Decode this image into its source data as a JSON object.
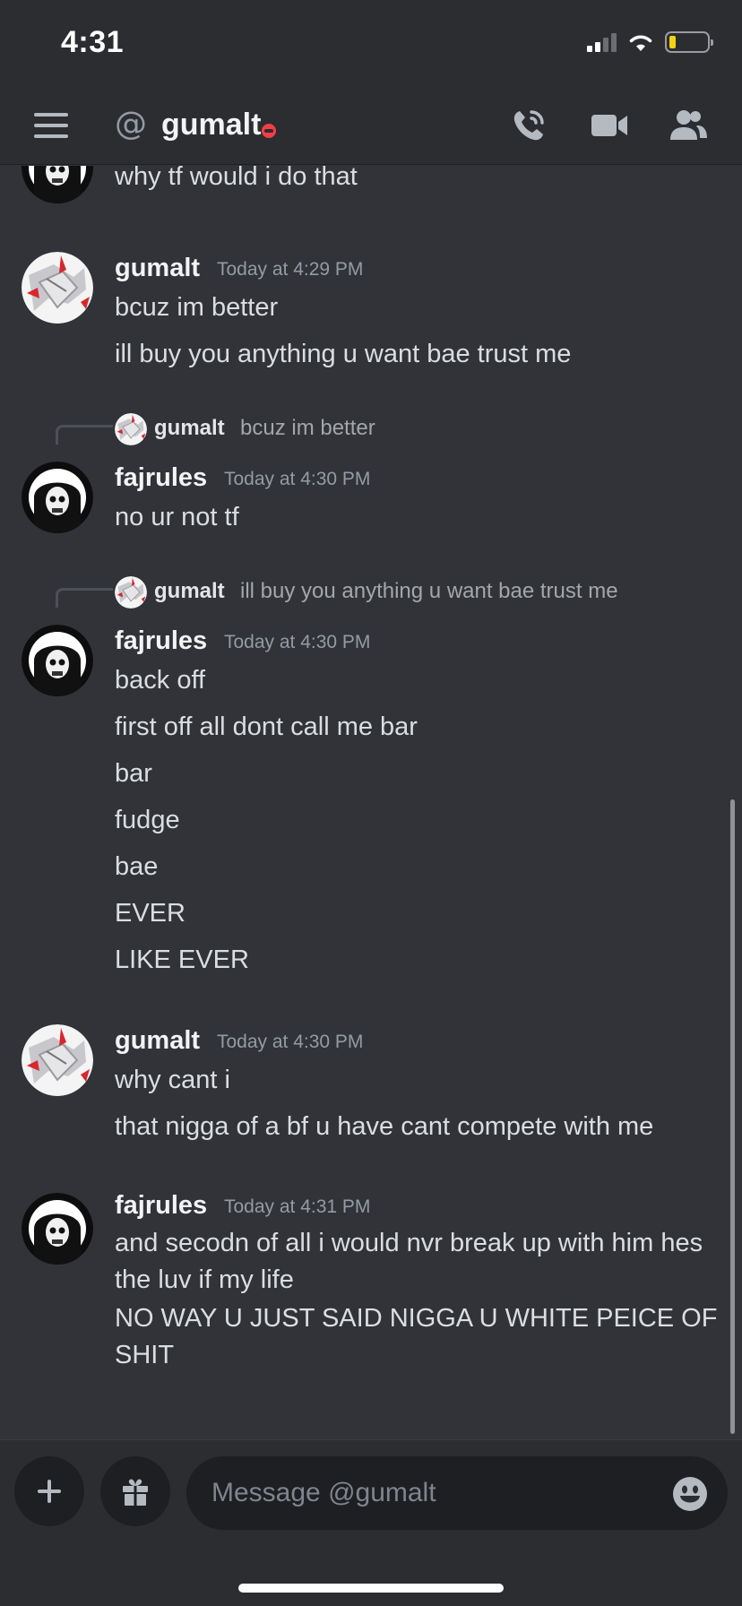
{
  "status_bar": {
    "time": "4:31"
  },
  "header": {
    "channel_name": "gumalt",
    "dm_prefix_icon": "at-icon",
    "status": "do-not-disturb",
    "actions": [
      "voice-call-icon",
      "video-call-icon",
      "members-icon"
    ]
  },
  "messages": [
    {
      "continuation_text": "why tf would i do that"
    },
    {
      "author": "gumalt",
      "timestamp": "Today at 4:29 PM",
      "lines": [
        "bcuz im better",
        "ill buy you anything u want bae trust me"
      ]
    },
    {
      "reply": {
        "author": "gumalt",
        "text": "bcuz im better"
      },
      "author": "fajrules",
      "timestamp": "Today at 4:30 PM",
      "lines": [
        "no ur not tf"
      ]
    },
    {
      "reply": {
        "author": "gumalt",
        "text": "ill buy you anything u want bae trust me"
      },
      "author": "fajrules",
      "timestamp": "Today at 4:30 PM",
      "lines": [
        "back off",
        "first off all dont call me bar",
        "bar",
        "fudge",
        "bae",
        "EVER",
        "LIKE EVER"
      ]
    },
    {
      "author": "gumalt",
      "timestamp": "Today at 4:30 PM",
      "lines": [
        "why cant i",
        "that nigga of a bf u have cant compete with me"
      ]
    },
    {
      "author": "fajrules",
      "timestamp": "Today at 4:31 PM",
      "lines": [
        "and secodn of all i would nvr break up with him hes the luv if my life",
        "NO WAY U JUST SAID NIGGA U WHITE PEICE OF SHIT"
      ]
    }
  ],
  "composer": {
    "placeholder": "Message @gumalt",
    "buttons": [
      "plus-icon",
      "gift-icon",
      "emoji-icon"
    ]
  },
  "colors": {
    "background": "#313338",
    "header": "#2b2d31",
    "input": "#1e1f22",
    "dnd": "#f23f43",
    "battery": "#f2d312"
  }
}
